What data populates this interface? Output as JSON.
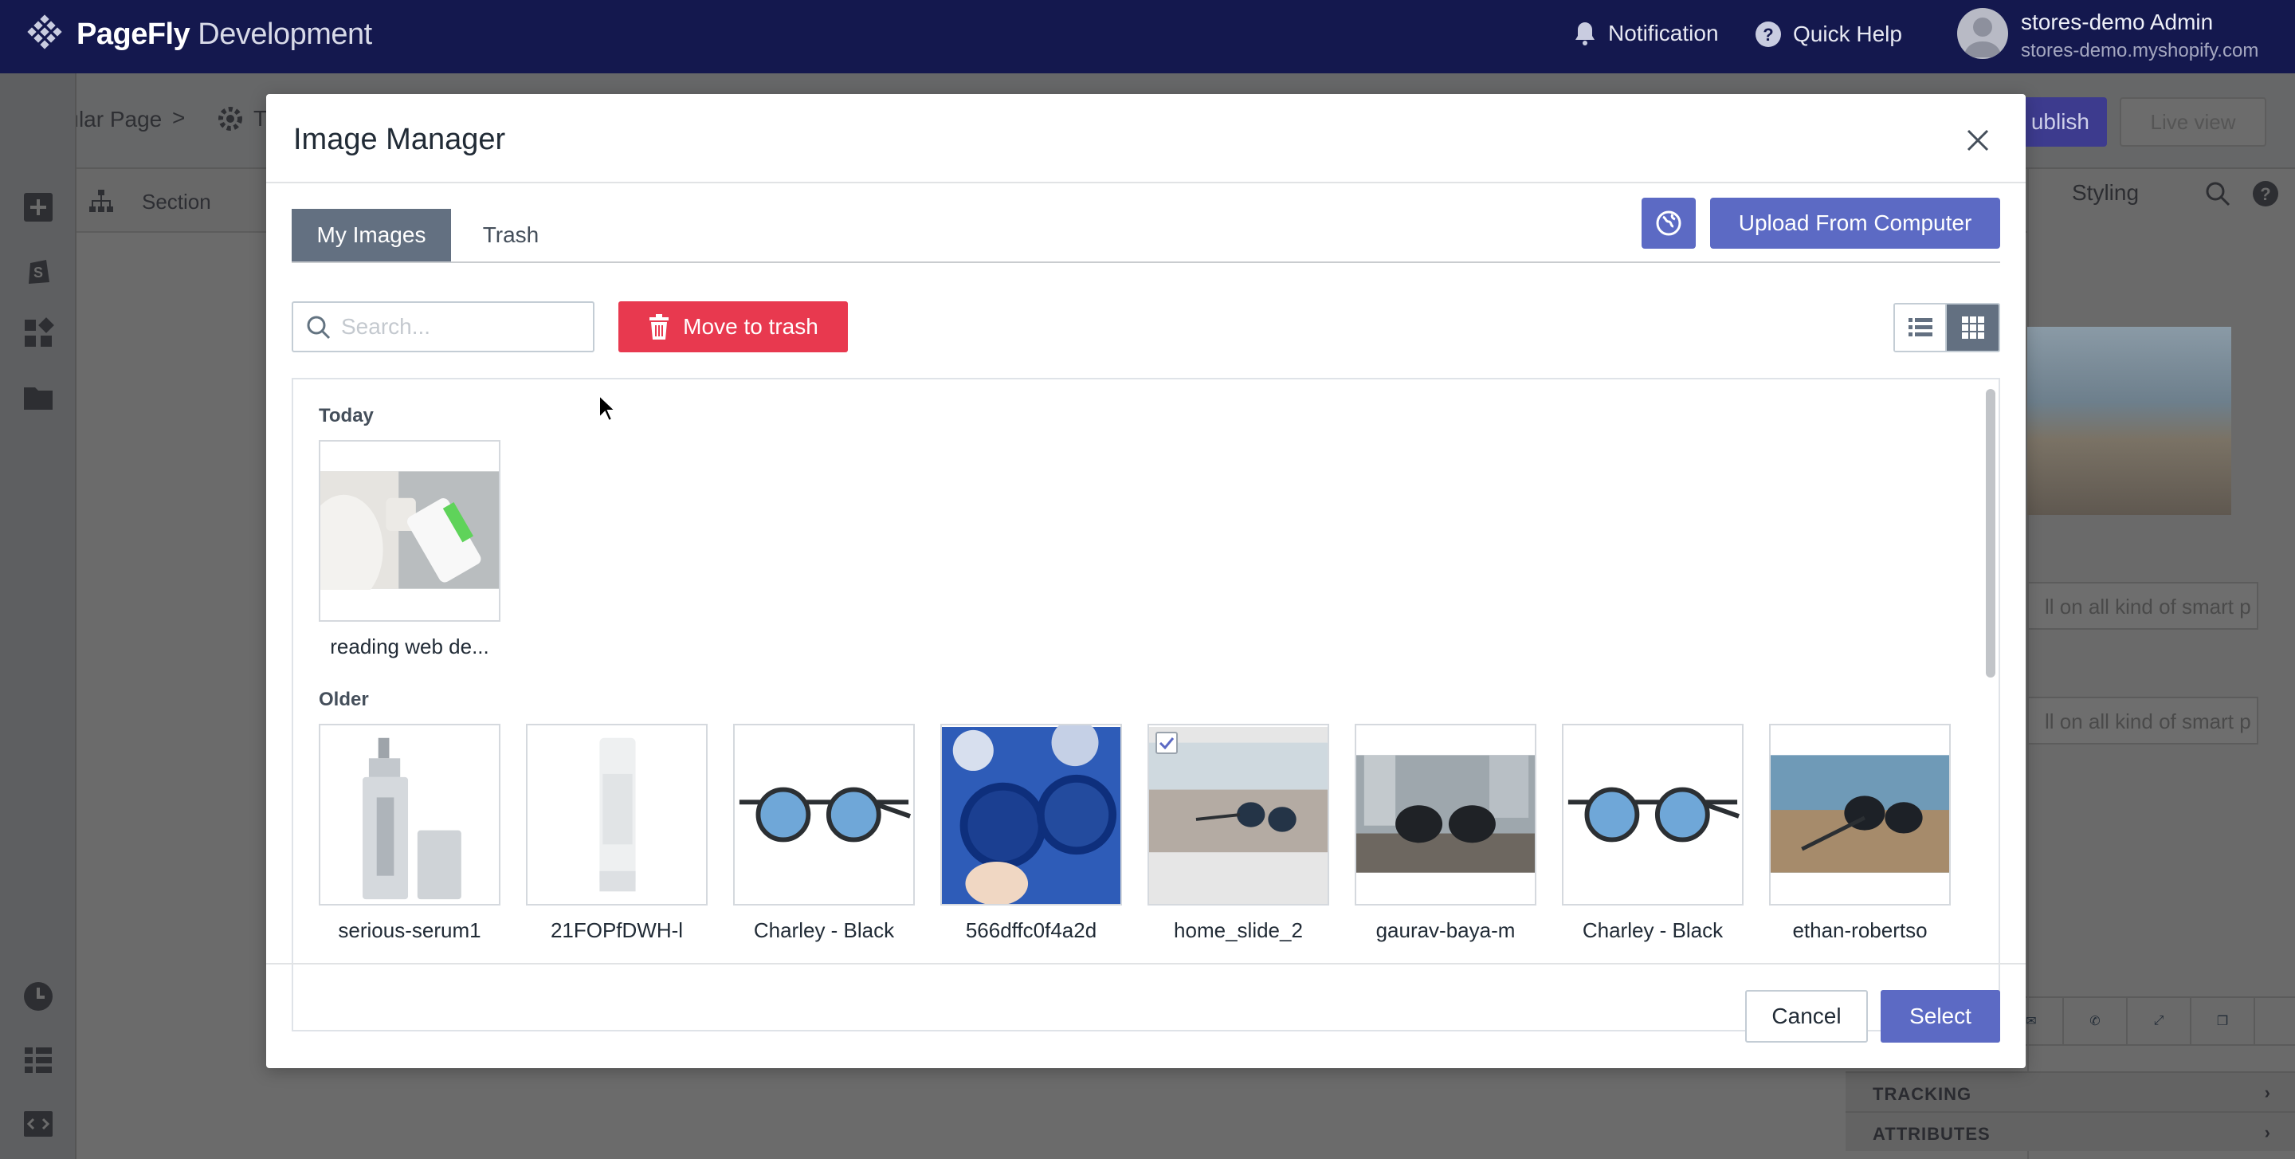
{
  "app": {
    "brand_bold": "PageFly",
    "brand_rest": " Development",
    "notification_label": "Notification",
    "quick_help_label": "Quick Help",
    "user_name": "stores-demo Admin",
    "user_store": "stores-demo.myshopify.com"
  },
  "background": {
    "breadcrumb": "Regular Page",
    "breadcrumb_sep": ">",
    "breadcrumb_next": "T",
    "section_label": "Section",
    "publish_label": "ublish",
    "liveview_label": "Live view",
    "styling_tab": "Styling",
    "panel_input_1": "ll on all kind of smart p",
    "panel_input_2": "ll on all kind of smart p",
    "tracking_label": "TRACKING",
    "attributes_label": "ATTRIBUTES"
  },
  "modal": {
    "title": "Image Manager",
    "tabs": [
      {
        "label": "My Images",
        "active": true
      },
      {
        "label": "Trash",
        "active": false
      }
    ],
    "upload_label": "Upload From Computer",
    "search_placeholder": "Search...",
    "trash_label": "Move to trash",
    "view_mode": "grid",
    "groups": {
      "today": {
        "label": "Today",
        "items": [
          {
            "caption": "reading web de...",
            "selected": false
          }
        ]
      },
      "older": {
        "label": "Older",
        "items": [
          {
            "caption": "serious-serum1",
            "selected": false
          },
          {
            "caption": "21FOPfDWH-l",
            "selected": false
          },
          {
            "caption": "Charley - Black",
            "selected": false
          },
          {
            "caption": "566dffc0f4a2d",
            "selected": false
          },
          {
            "caption": "home_slide_2",
            "selected": true
          },
          {
            "caption": "gaurav-baya-m",
            "selected": false
          },
          {
            "caption": "Charley - Black",
            "selected": false
          },
          {
            "caption": "ethan-robertso",
            "selected": false
          }
        ]
      }
    },
    "cancel_label": "Cancel",
    "select_label": "Select"
  },
  "colors": {
    "topbar": "#14184e",
    "primary": "#5c6ac4",
    "danger": "#e8394f",
    "tab_active": "#637081"
  }
}
